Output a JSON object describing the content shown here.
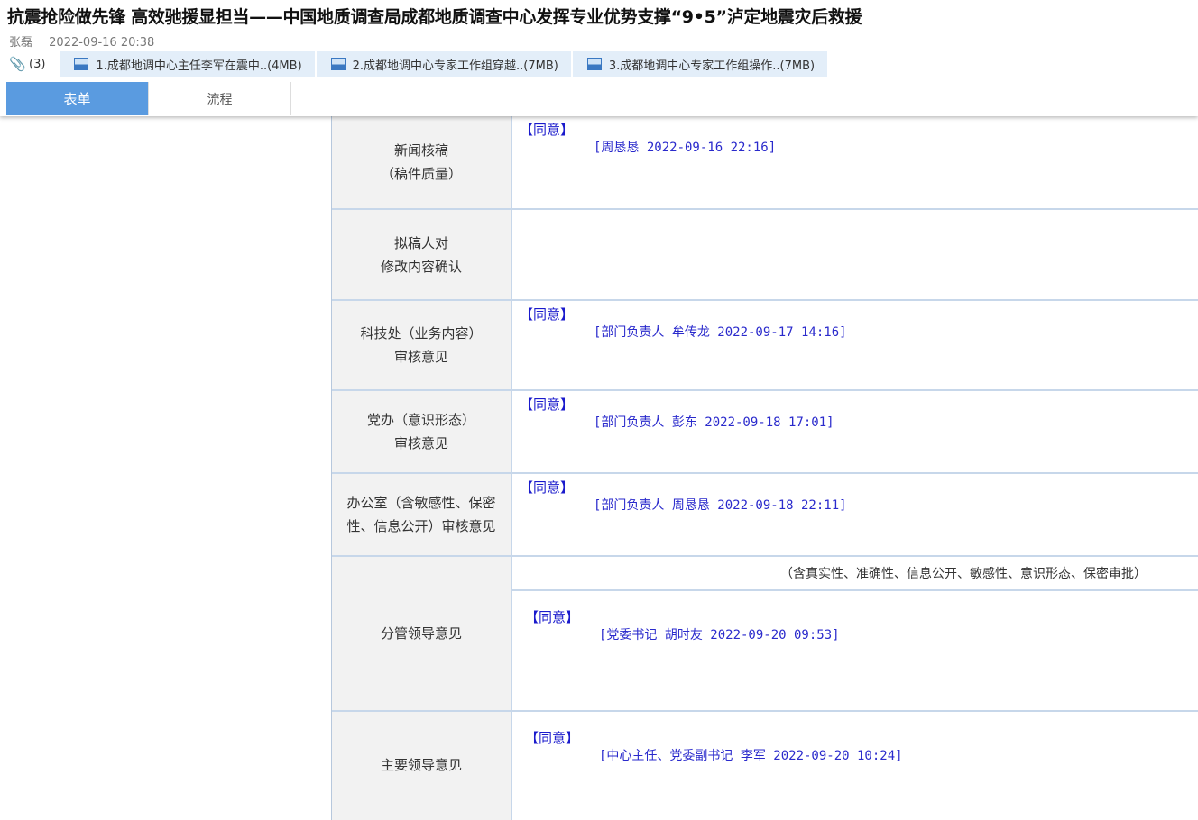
{
  "doc": {
    "title": "抗震抢险做先锋 高效驰援显担当——中国地质调查局成都地质调查中心发挥专业优势支撑“9•5”泸定地震灾后救援",
    "author": "张磊",
    "date": "2022-09-16 20:38",
    "attachment_count": "(3)",
    "attachments": [
      {
        "label": "1.成都地调中心主任李军在震中..(4MB)"
      },
      {
        "label": "2.成都地调中心专家工作组穿越..(7MB)"
      },
      {
        "label": "3.成都地调中心专家工作组操作..(7MB)"
      }
    ]
  },
  "tabs": [
    {
      "label": "表单"
    },
    {
      "label": "流程"
    }
  ],
  "form": {
    "rows": [
      {
        "label_l1": "新闻核稿",
        "label_l2": "（稿件质量）",
        "agree": "【同意】",
        "sign": "[周恳恳 2022-09-16 22:16]"
      },
      {
        "label_l1": "拟稿人对",
        "label_l2": "修改内容确认",
        "agree": "",
        "sign": ""
      },
      {
        "label_l1": "科技处（业务内容）",
        "label_l2": "审核意见",
        "agree": "【同意】",
        "sign": "[部门负责人 牟传龙 2022-09-17 14:16]"
      },
      {
        "label_l1": "党办（意识形态）",
        "label_l2": "审核意见",
        "agree": "【同意】",
        "sign": "[部门负责人 彭东 2022-09-18 17:01]"
      },
      {
        "label_l1": "办公室（含敏感性、保密",
        "label_l2": "性、信息公开）审核意见",
        "agree": "【同意】",
        "sign": "[部门负责人 周恳恳 2022-09-18 22:11]"
      },
      {
        "label_l1": "分管领导意见",
        "label_l2": "",
        "note": "（含真实性、准确性、信息公开、敏感性、意识形态、保密审批）",
        "agree": "【同意】",
        "sign": "[党委书记 胡时友 2022-09-20 09:53]"
      },
      {
        "label_l1": "主要领导意见",
        "label_l2": "",
        "agree": "【同意】",
        "sign": "[中心主任、党委副书记 李军 2022-09-20 10:24]"
      }
    ]
  }
}
